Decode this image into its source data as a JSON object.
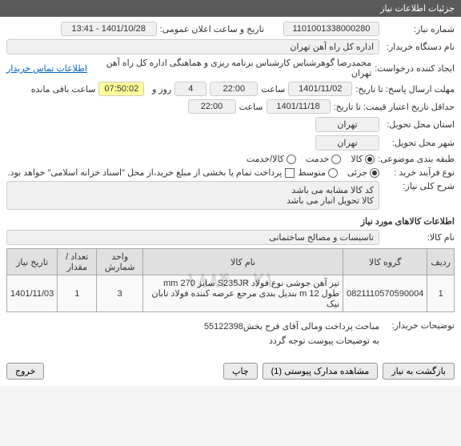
{
  "header": {
    "title": "جزئیات اطلاعات نیاز"
  },
  "fields": {
    "need_no_label": "شماره نیاز:",
    "need_no": "1101001338000280",
    "announce_label": "تاریخ و ساعت اعلان عمومی:",
    "announce": "1401/10/28 - 13:41",
    "buyer_label": "نام دستگاه خریدار:",
    "buyer": "اداره کل راه آهن تهران",
    "requester_label": "ایجاد کننده درخواست:",
    "requester": "محمدرضا گوهرشناس کارشناس برنامه ریزی و هماهنگی اداره کل راه آهن تهران",
    "contact_link": "اطلاعات تماس خریدار",
    "deadline_label": "مهلت ارسال پاسخ: تا تاریخ:",
    "deadline_date": "1401/11/02",
    "time_label": "ساعت",
    "deadline_time": "22:00",
    "day_label": "روز و",
    "days": "4",
    "remaining_label": "ساعت باقی مانده",
    "countdown": "07:50:02",
    "validity_label": "حداقل تاریخ اعتبار قیمت: تا تاریخ:",
    "validity_date": "1401/11/18",
    "validity_time": "22:00",
    "province_label": "استان محل تحویل:",
    "province": "تهران",
    "city_label": "شهر محل تحویل:",
    "city": "تهران",
    "subject_cat_label": "طبقه بندی موضوعی:",
    "goods": "کالا",
    "service": "خدمت",
    "goods_service": "کالا/خدمت",
    "purchase_type_label": "نوع فرآیند خرید :",
    "partial": "جزئی",
    "medium": "متوسط",
    "purchase_note": "پرداخت تمام یا بخشی از مبلغ خرید،از محل \"اسناد خزانه اسلامی\" خواهد بود.",
    "desc_label": "شرح کلی نیاز:",
    "desc_line1": "کد کالا مشابه می باشد",
    "desc_line2": "کالا تحویل انبار می باشد",
    "items_section": "اطلاعات کالاهای مورد نیاز",
    "item_name_label": "نام کالا:",
    "item_name_value": "تاسیسات و مصالح ساختمانی",
    "notes_label": "توضیحات خریدار:",
    "note1": "مباحث پرداخت ومالی  آقای فرح بخش55122398",
    "note2": "به توضیحات پیوست توجه گردد"
  },
  "table": {
    "headers": {
      "row": "ردیف",
      "code": "گروه کالا",
      "name": "نام کالا",
      "unit": "واحد شمارش",
      "qty": "تعداد / مقدار",
      "date": "تاریخ نیاز"
    },
    "rows": [
      {
        "row": "1",
        "code": "0821110570590004",
        "name": "تیر آهن جوشی نوع فولاد S235JR سایز mm 270 طول m 12 بندیل بندی مرجع عرضه کننده فولاد تابان نیک",
        "unit": "3",
        "qty": "1",
        "date": "1401/11/03"
      }
    ]
  },
  "watermark": "۱۸۸۴۰۰۲۱",
  "buttons": {
    "back": "بازگشت به نیاز",
    "attachments": "مشاهده مدارک پیوستی (1)",
    "print": "چاپ",
    "exit": "خروج"
  }
}
